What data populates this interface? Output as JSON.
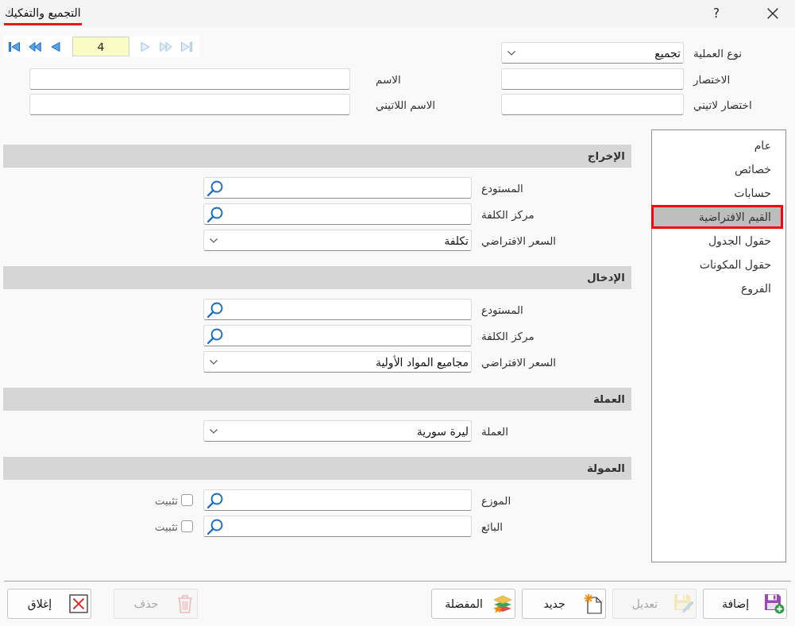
{
  "window": {
    "title": "التجميع والتفكيك",
    "help": "?"
  },
  "navigator": {
    "back_buttons": [
      {
        "kind": "first",
        "disabled": false
      },
      {
        "kind": "fast_back",
        "disabled": false
      },
      {
        "kind": "back",
        "disabled": false
      }
    ],
    "record": "4",
    "forward_buttons": [
      {
        "kind": "forward",
        "disabled": true
      },
      {
        "kind": "fast_forward",
        "disabled": true
      },
      {
        "kind": "last",
        "disabled": true
      }
    ]
  },
  "header_form": {
    "rows": [
      [
        {
          "label": "نوع العملية",
          "kind": "dropdown",
          "value": "تجميع"
        }
      ],
      [
        {
          "label": "الاختصار",
          "kind": "text"
        },
        {
          "label": "الاسم",
          "kind": "text"
        }
      ],
      [
        {
          "label": "اختصار لاتيني",
          "kind": "text"
        },
        {
          "label": "الاسم اللاتيني",
          "kind": "text"
        }
      ]
    ]
  },
  "sidebar": {
    "items": [
      {
        "label": "عام",
        "selected": false
      },
      {
        "label": "خصائص",
        "selected": false
      },
      {
        "label": "حسابات",
        "selected": false
      },
      {
        "label": "القيم الافتراضية",
        "selected": true
      },
      {
        "label": "حقول الجدول",
        "selected": false
      },
      {
        "label": "حقول المكونات",
        "selected": false
      },
      {
        "label": "الفروع",
        "selected": false
      }
    ]
  },
  "sections": [
    {
      "title": "الإخراج",
      "fields": [
        {
          "label": "المستودع",
          "kind": "search"
        },
        {
          "label": "مركز الكلفة",
          "kind": "search"
        },
        {
          "label": "السعر الافتراضي",
          "kind": "dropdown",
          "value": "تكلفة"
        }
      ]
    },
    {
      "title": "الإدخال",
      "fields": [
        {
          "label": "المستودع",
          "kind": "search"
        },
        {
          "label": "مركز الكلفة",
          "kind": "search"
        },
        {
          "label": "السعر الافتراضي",
          "kind": "dropdown",
          "value": "مجاميع المواد الأولية"
        }
      ]
    },
    {
      "title": "العملة",
      "fields": [
        {
          "label": "العملة",
          "kind": "dropdown",
          "value": "ليرة سورية"
        }
      ]
    },
    {
      "title": "العمولة",
      "fields": [
        {
          "label": "الموزع",
          "kind": "search",
          "pin": {
            "label": "تثبيت",
            "checked": false
          }
        },
        {
          "label": "البائع",
          "kind": "search",
          "pin": {
            "label": "تثبيت",
            "checked": false
          }
        }
      ]
    }
  ],
  "toolbar": {
    "main": [
      {
        "label": "إضافة",
        "kind": "add",
        "disabled": false
      },
      {
        "label": "تعديل",
        "kind": "edit",
        "disabled": true
      },
      {
        "label": "جديد",
        "kind": "new",
        "disabled": false
      },
      {
        "label": "المفضلة",
        "kind": "favorites",
        "disabled": false
      }
    ],
    "secondary": [
      {
        "label": "حذف",
        "kind": "delete",
        "disabled": true
      },
      {
        "label": "إغلاق",
        "kind": "close",
        "disabled": false
      }
    ]
  }
}
